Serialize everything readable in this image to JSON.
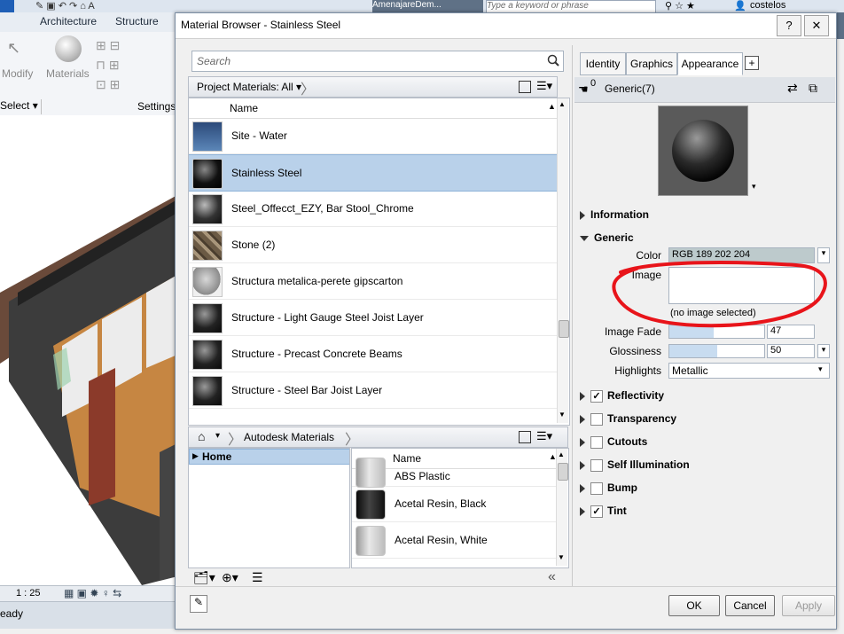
{
  "revit": {
    "tabs": [
      "Architecture",
      "Structure"
    ],
    "ribbon": {
      "modify_label": "Modify",
      "materials_label": "Materials",
      "select_label": "Select",
      "settings_label": "Settings"
    },
    "search_placeholder": "Type a keyword or phrase",
    "user": "costelos",
    "tab_title": "AmenajareDem...",
    "scale": "1 : 25",
    "status": "eady"
  },
  "dialog": {
    "title": "Material Browser - Stainless Steel",
    "help_label": "?",
    "close_label": "✕",
    "search_placeholder": "Search",
    "project_filter": "Project Materials: All",
    "name_header": "Name",
    "project_materials": [
      {
        "name": "Site - Water",
        "thumb": "water"
      },
      {
        "name": "Stainless Steel",
        "thumb": "steel",
        "selected": true
      },
      {
        "name": "Steel_Offecct_EZY, Bar Stool_Chrome",
        "thumb": "chrome"
      },
      {
        "name": "Stone (2)",
        "thumb": "stone"
      },
      {
        "name": "Structura metalica-perete gipscarton",
        "thumb": "egg"
      },
      {
        "name": "Structure - Light Gauge Steel Joist Layer",
        "thumb": "dark"
      },
      {
        "name": "Structure - Precast Concrete Beams",
        "thumb": "dark"
      },
      {
        "name": "Structure - Steel Bar Joist Layer",
        "thumb": "dark"
      }
    ],
    "library_breadcrumb": "Autodesk Materials",
    "library_tree": [
      {
        "label": "Home"
      }
    ],
    "library_name_header": "Name",
    "library_items": [
      {
        "name": "ABS Plastic",
        "thumb": "white-cyl"
      },
      {
        "name": "Acetal Resin, Black",
        "thumb": "black-cyl"
      },
      {
        "name": "Acetal Resin, White",
        "thumb": "white-cyl"
      }
    ],
    "tabs": [
      "Identity",
      "Graphics",
      "Appearance"
    ],
    "add_tab_label": "+",
    "asset_count": "0",
    "asset_name": "Generic(7)",
    "sections": {
      "information": "Information",
      "generic": "Generic",
      "reflectivity": "Reflectivity",
      "transparency": "Transparency",
      "cutouts": "Cutouts",
      "self_illumination": "Self Illumination",
      "bump": "Bump",
      "tint": "Tint"
    },
    "generic": {
      "color_label": "Color",
      "color_value": "RGB 189 202 204",
      "image_label": "Image",
      "image_placeholder": "(no image selected)",
      "image_fade_label": "Image Fade",
      "image_fade_value": "47",
      "image_fade_fraction": 0.47,
      "glossiness_label": "Glossiness",
      "glossiness_value": "50",
      "glossiness_fraction": 0.5,
      "highlights_label": "Highlights",
      "highlights_value": "Metallic"
    },
    "buttons": {
      "ok": "OK",
      "cancel": "Cancel",
      "apply": "Apply"
    },
    "annotation_color": "#e8141a"
  }
}
